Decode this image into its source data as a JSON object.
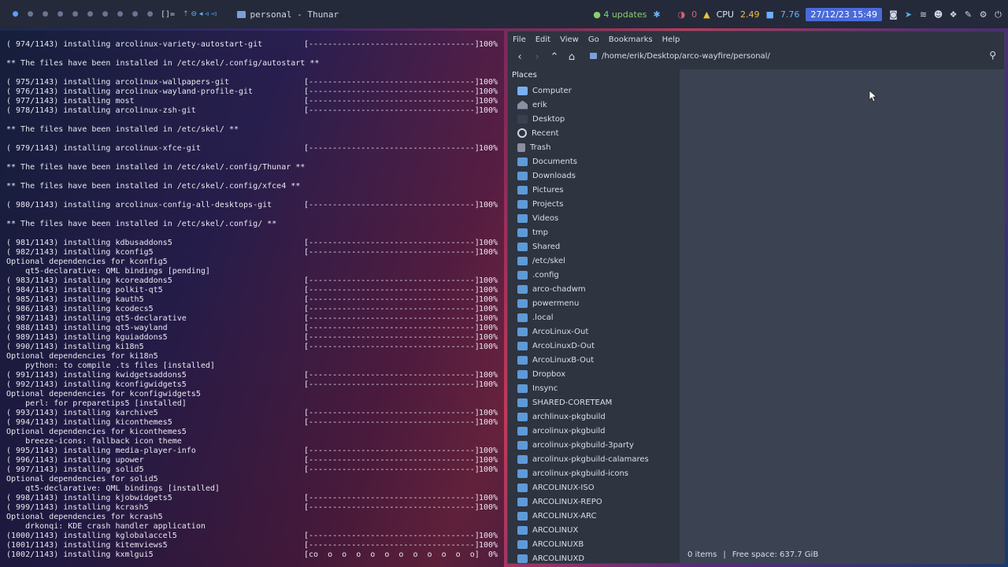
{
  "topbar": {
    "workspaces": [
      "●",
      "●",
      "●",
      "●",
      "●",
      "●",
      "●",
      "●",
      "●",
      "●"
    ],
    "layout": "[]=",
    "window_title": "personal - Thunar",
    "updates": "4 updates",
    "notif_count": "0",
    "cpu_label": "CPU",
    "cpu_value": "2.49",
    "mem_value": "7.76",
    "datetime": "27/12/23 15:49"
  },
  "terminal": {
    "lines": [
      {
        "t": "( 974/1143) installing arcolinux-variety-autostart-git",
        "bar": true,
        "pct": "100%"
      },
      {
        "t": "",
        "bar": false
      },
      {
        "t": "** The files have been installed in /etc/skel/.config/autostart **",
        "bar": false
      },
      {
        "t": "",
        "bar": false
      },
      {
        "t": "( 975/1143) installing arcolinux-wallpapers-git",
        "bar": true,
        "pct": "100%"
      },
      {
        "t": "( 976/1143) installing arcolinux-wayland-profile-git",
        "bar": true,
        "pct": "100%"
      },
      {
        "t": "( 977/1143) installing most",
        "bar": true,
        "pct": "100%"
      },
      {
        "t": "( 978/1143) installing arcolinux-zsh-git",
        "bar": true,
        "pct": "100%"
      },
      {
        "t": "",
        "bar": false
      },
      {
        "t": "** The files have been installed in /etc/skel/ **",
        "bar": false
      },
      {
        "t": "",
        "bar": false
      },
      {
        "t": "( 979/1143) installing arcolinux-xfce-git",
        "bar": true,
        "pct": "100%"
      },
      {
        "t": "",
        "bar": false
      },
      {
        "t": "** The files have been installed in /etc/skel/.config/Thunar **",
        "bar": false
      },
      {
        "t": "",
        "bar": false
      },
      {
        "t": "** The files have been installed in /etc/skel/.config/xfce4 **",
        "bar": false
      },
      {
        "t": "",
        "bar": false
      },
      {
        "t": "( 980/1143) installing arcolinux-config-all-desktops-git",
        "bar": true,
        "pct": "100%"
      },
      {
        "t": "",
        "bar": false
      },
      {
        "t": "** The files have been installed in /etc/skel/.config/ **",
        "bar": false
      },
      {
        "t": "",
        "bar": false
      },
      {
        "t": "( 981/1143) installing kdbusaddons5",
        "bar": true,
        "pct": "100%"
      },
      {
        "t": "( 982/1143) installing kconfig5",
        "bar": true,
        "pct": "100%"
      },
      {
        "t": "Optional dependencies for kconfig5",
        "bar": false
      },
      {
        "t": "    qt5-declarative: QML bindings [pending]",
        "bar": false
      },
      {
        "t": "( 983/1143) installing kcoreaddons5",
        "bar": true,
        "pct": "100%"
      },
      {
        "t": "( 984/1143) installing polkit-qt5",
        "bar": true,
        "pct": "100%"
      },
      {
        "t": "( 985/1143) installing kauth5",
        "bar": true,
        "pct": "100%"
      },
      {
        "t": "( 986/1143) installing kcodecs5",
        "bar": true,
        "pct": "100%"
      },
      {
        "t": "( 987/1143) installing qt5-declarative",
        "bar": true,
        "pct": "100%"
      },
      {
        "t": "( 988/1143) installing qt5-wayland",
        "bar": true,
        "pct": "100%"
      },
      {
        "t": "( 989/1143) installing kguiaddons5",
        "bar": true,
        "pct": "100%"
      },
      {
        "t": "( 990/1143) installing ki18n5",
        "bar": true,
        "pct": "100%"
      },
      {
        "t": "Optional dependencies for ki18n5",
        "bar": false
      },
      {
        "t": "    python: to compile .ts files [installed]",
        "bar": false
      },
      {
        "t": "( 991/1143) installing kwidgetsaddons5",
        "bar": true,
        "pct": "100%"
      },
      {
        "t": "( 992/1143) installing kconfigwidgets5",
        "bar": true,
        "pct": "100%"
      },
      {
        "t": "Optional dependencies for kconfigwidgets5",
        "bar": false
      },
      {
        "t": "    perl: for preparetips5 [installed]",
        "bar": false
      },
      {
        "t": "( 993/1143) installing karchive5",
        "bar": true,
        "pct": "100%"
      },
      {
        "t": "( 994/1143) installing kiconthemes5",
        "bar": true,
        "pct": "100%"
      },
      {
        "t": "Optional dependencies for kiconthemes5",
        "bar": false
      },
      {
        "t": "    breeze-icons: fallback icon theme",
        "bar": false
      },
      {
        "t": "( 995/1143) installing media-player-info",
        "bar": true,
        "pct": "100%"
      },
      {
        "t": "( 996/1143) installing upower",
        "bar": true,
        "pct": "100%"
      },
      {
        "t": "( 997/1143) installing solid5",
        "bar": true,
        "pct": "100%"
      },
      {
        "t": "Optional dependencies for solid5",
        "bar": false
      },
      {
        "t": "    qt5-declarative: QML bindings [installed]",
        "bar": false
      },
      {
        "t": "( 998/1143) installing kjobwidgets5",
        "bar": true,
        "pct": "100%"
      },
      {
        "t": "( 999/1143) installing kcrash5",
        "bar": true,
        "pct": "100%"
      },
      {
        "t": "Optional dependencies for kcrash5",
        "bar": false
      },
      {
        "t": "    drkonqi: KDE crash handler application",
        "bar": false
      },
      {
        "t": "(1000/1143) installing kglobalaccel5",
        "bar": true,
        "pct": "100%"
      },
      {
        "t": "(1001/1143) installing kitemviews5",
        "bar": true,
        "pct": "100%"
      },
      {
        "t": "(1002/1143) installing kxmlgui5",
        "bar": "partial",
        "pct": "0%"
      }
    ],
    "bar_full": "[-----------------------------------]",
    "bar_partial": "[co  o  o  o  o  o  o  o  o  o  o  o]"
  },
  "thunar": {
    "menu": [
      "File",
      "Edit",
      "View",
      "Go",
      "Bookmarks",
      "Help"
    ],
    "path": "/home/erik/Desktop/arco-wayfire/personal/",
    "places_title": "Places",
    "places": [
      {
        "label": "Computer",
        "icon": "computer-icon"
      },
      {
        "label": "erik",
        "icon": "home-icon"
      },
      {
        "label": "Desktop",
        "icon": "desktop-icon"
      },
      {
        "label": "Recent",
        "icon": "recent-icon"
      },
      {
        "label": "Trash",
        "icon": "trash-icon"
      },
      {
        "label": "Documents",
        "icon": "folder-icon"
      },
      {
        "label": "Downloads",
        "icon": "folder-icon"
      },
      {
        "label": "Pictures",
        "icon": "folder-icon"
      },
      {
        "label": "Projects",
        "icon": "folder-icon"
      },
      {
        "label": "Videos",
        "icon": "folder-icon"
      },
      {
        "label": "tmp",
        "icon": "folder-icon"
      },
      {
        "label": "Shared",
        "icon": "folder-icon"
      },
      {
        "label": "/etc/skel",
        "icon": "folder-icon"
      },
      {
        "label": ".config",
        "icon": "folder-icon"
      },
      {
        "label": "arco-chadwm",
        "icon": "folder-icon"
      },
      {
        "label": "powermenu",
        "icon": "folder-icon"
      },
      {
        "label": ".local",
        "icon": "folder-icon"
      },
      {
        "label": "ArcoLinux-Out",
        "icon": "folder-icon"
      },
      {
        "label": "ArcoLinuxD-Out",
        "icon": "folder-icon"
      },
      {
        "label": "ArcoLinuxB-Out",
        "icon": "folder-icon"
      },
      {
        "label": "Dropbox",
        "icon": "folder-icon"
      },
      {
        "label": "Insync",
        "icon": "folder-icon"
      },
      {
        "label": "SHARED-CORETEAM",
        "icon": "folder-icon"
      },
      {
        "label": "archlinux-pkgbuild",
        "icon": "folder-icon"
      },
      {
        "label": "arcolinux-pkgbuild",
        "icon": "folder-icon"
      },
      {
        "label": "arcolinux-pkgbuild-3party",
        "icon": "folder-icon"
      },
      {
        "label": "arcolinux-pkgbuild-calamares",
        "icon": "folder-icon"
      },
      {
        "label": "arcolinux-pkgbuild-icons",
        "icon": "folder-icon"
      },
      {
        "label": "ARCOLINUX-ISO",
        "icon": "folder-icon"
      },
      {
        "label": "ARCOLINUX-REPO",
        "icon": "folder-icon"
      },
      {
        "label": "ARCOLINUX-ARC",
        "icon": "folder-icon"
      },
      {
        "label": "ARCOLINUX",
        "icon": "folder-icon"
      },
      {
        "label": "ARCOLINUXB",
        "icon": "folder-icon"
      },
      {
        "label": "ARCOLINUXD",
        "icon": "folder-icon"
      }
    ],
    "status_items": "0 items",
    "status_sep": "|",
    "status_free": "Free space: 637.7 GiB"
  }
}
